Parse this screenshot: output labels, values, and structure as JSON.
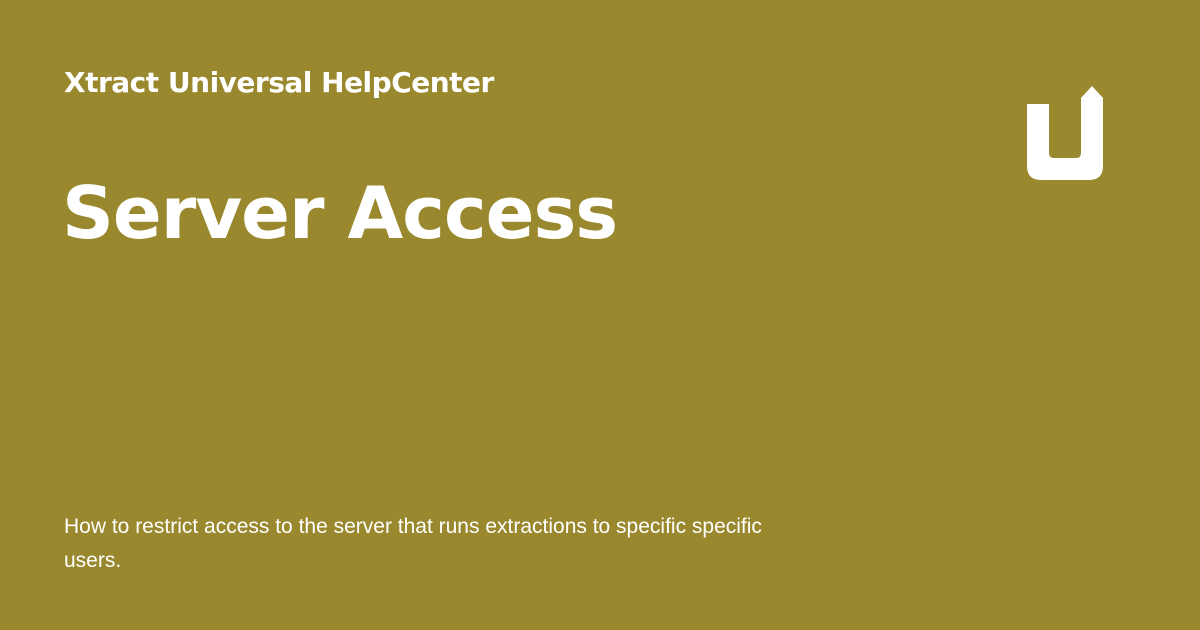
{
  "card": {
    "background_color": "#99882d",
    "text_color": "#ffffff",
    "site_title": "Xtract Universal HelpCenter",
    "page_title": "Server Access",
    "description": "How to restrict access to the server that runs extractions to specific specific users.",
    "logo_icon": "u-arrow-logo-icon"
  }
}
